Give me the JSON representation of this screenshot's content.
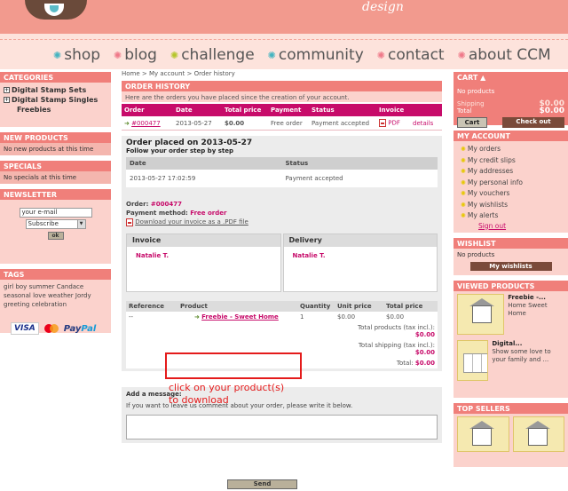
{
  "header": {
    "brand_tail": "design",
    "nav": [
      {
        "label": "shop",
        "icon": "star-icon",
        "color": "#46b4c0"
      },
      {
        "label": "blog",
        "icon": "star-icon",
        "color": "#ef7a8a"
      },
      {
        "label": "challenge",
        "icon": "star-icon",
        "color": "#b5c62c"
      },
      {
        "label": "community",
        "icon": "star-icon",
        "color": "#46b4c0"
      },
      {
        "label": "contact",
        "icon": "star-icon",
        "color": "#ef7a8a"
      },
      {
        "label": "about CCM",
        "icon": "star-icon",
        "color": "#ef7a8a"
      }
    ]
  },
  "left": {
    "categories_title": "CATEGORIES",
    "categories": [
      "Digital Stamp Sets",
      "Digital Stamp Singles",
      "Freebies"
    ],
    "new_products_title": "NEW PRODUCTS",
    "new_products_text": "No new products at this time",
    "specials_title": "SPECIALS",
    "specials_text": "No specials at this time",
    "newsletter_title": "NEWSLETTER",
    "newsletter_input": "your e-mail",
    "newsletter_select": "Subscribe",
    "newsletter_ok": "ok",
    "tags_title": "TAGS",
    "tags": [
      "girl",
      "boy",
      "summer",
      "Candace",
      "seasonal",
      "love",
      "weather",
      "Jordy",
      "greeting",
      "celebration"
    ],
    "payment": {
      "visa": "VISA",
      "paypal_a": "Pay",
      "paypal_b": "Pal"
    }
  },
  "main": {
    "breadcrumb": "Home > My account > Order history",
    "title": "ORDER HISTORY",
    "intro": "Here are the orders you have placed since the creation of your account.",
    "order_cols": [
      "Order",
      "Date",
      "Total price",
      "Payment",
      "Status",
      "Invoice"
    ],
    "order_row": {
      "id": "#000477",
      "date": "2013-05-27",
      "total": "$0.00",
      "payment": "Free order",
      "status": "Payment accepted",
      "pdf": "PDF",
      "details": "details"
    },
    "placed_on": "Order placed on 2013-05-27",
    "follow": "Follow your order step by step",
    "status_cols": [
      "Date",
      "Status"
    ],
    "status_row": {
      "date": "2013-05-27 17:02:59",
      "status": "Payment accepted"
    },
    "order_label": "Order:",
    "order_ref": "#000477",
    "payment_label": "Payment method:",
    "payment_method": "Free order",
    "download_invoice": "Download your invoice as a .PDF file",
    "invoice_title": "Invoice",
    "delivery_title": "Delivery",
    "invoice_name": "Natalie T.",
    "delivery_name": "Natalie T.",
    "product_cols": [
      "Reference",
      "Product",
      "Quantity",
      "Unit price",
      "Total price"
    ],
    "product_row": {
      "ref": "--",
      "name": "Freebie - Sweet Home",
      "qty": "1",
      "unit": "$0.00",
      "total": "$0.00"
    },
    "totals": [
      {
        "label": "Total products (tax incl.):",
        "value": "$0.00"
      },
      {
        "label": "Total shipping (tax incl.):",
        "value": "$0.00"
      },
      {
        "label": "Total:",
        "value": "$0.00"
      }
    ],
    "annotation_line1": "click on your product(s)",
    "annotation_line2": "to download",
    "message_title": "Add a message:",
    "message_desc": "If you want to leave us comment about your order, please write it below.",
    "send": "Send"
  },
  "right": {
    "cart_title": "CART",
    "cart_empty": "No products",
    "shipping_label": "Shipping",
    "shipping_value": "$0.00",
    "total_label": "Total",
    "total_value": "$0.00",
    "cart_btn": "Cart",
    "checkout_btn": "Check out",
    "account_title": "MY ACCOUNT",
    "account_items": [
      "My orders",
      "My credit slips",
      "My addresses",
      "My personal info",
      "My vouchers",
      "My wishlists",
      "My alerts"
    ],
    "signout": "Sign out",
    "wishlist_title": "WISHLIST",
    "wishlist_text": "No products",
    "wishlist_btn": "My wishlists",
    "viewed_title": "VIEWED PRODUCTS",
    "viewed": [
      {
        "name": "Freebie -...",
        "desc": "Home Sweet Home"
      },
      {
        "name": "Digital...",
        "desc": "Show some love to your family and ..."
      }
    ],
    "sellers_title": "TOP SELLERS"
  }
}
